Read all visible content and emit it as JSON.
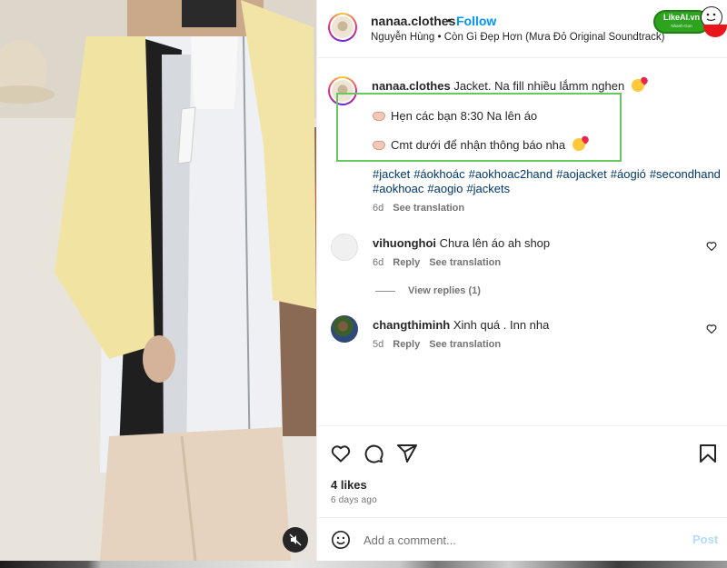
{
  "post": {
    "username": "nanaa.clothes",
    "separator": "•",
    "follow_label": "Follow",
    "audio": "Nguyễn Hùng • Còn Gì Đẹp Hơn (Mưa Đỏ Original Soundtrack)",
    "avatar_caption": "nana clothes"
  },
  "watermark": {
    "brand": "LikeAI.vn",
    "tagline": "Nhanh-Gọn"
  },
  "caption": {
    "username": "nanaa.clothes",
    "text": "Jacket. Na fill nhiều lắmm nghen",
    "line1": "Hẹn các bạn 8:30 Na lên áo",
    "line2": "Cmt dưới để nhận thông báo nha",
    "hashtags": [
      "#jacket",
      "#áokhoác",
      "#aokhoac2hand",
      "#aojacket",
      "#áogió",
      "#secondhand",
      "#aokhoac",
      "#aogio",
      "#jackets"
    ],
    "time": "6d",
    "see_translation": "See translation"
  },
  "comments": [
    {
      "username": "vihuonghoi",
      "text": "Chưa lên áo ah shop",
      "time": "6d",
      "reply": "Reply",
      "see_translation": "See translation"
    },
    {
      "username": "changthiminh",
      "text": "Xinh quá . Inn nha",
      "time": "5d",
      "reply": "Reply",
      "see_translation": "See translation"
    }
  ],
  "view_replies": "View replies (1)",
  "actions": {
    "icons": [
      "heart-icon",
      "comment-icon",
      "share-icon",
      "bookmark-icon"
    ]
  },
  "likes": "4 likes",
  "posted_ago": "6 days ago",
  "comment_box": {
    "placeholder": "Add a comment...",
    "post_label": "Post"
  },
  "colors": {
    "link": "#0095f6",
    "hashtag": "#00376b",
    "highlight": "#67c862",
    "post_disabled": "#b3dbff"
  }
}
